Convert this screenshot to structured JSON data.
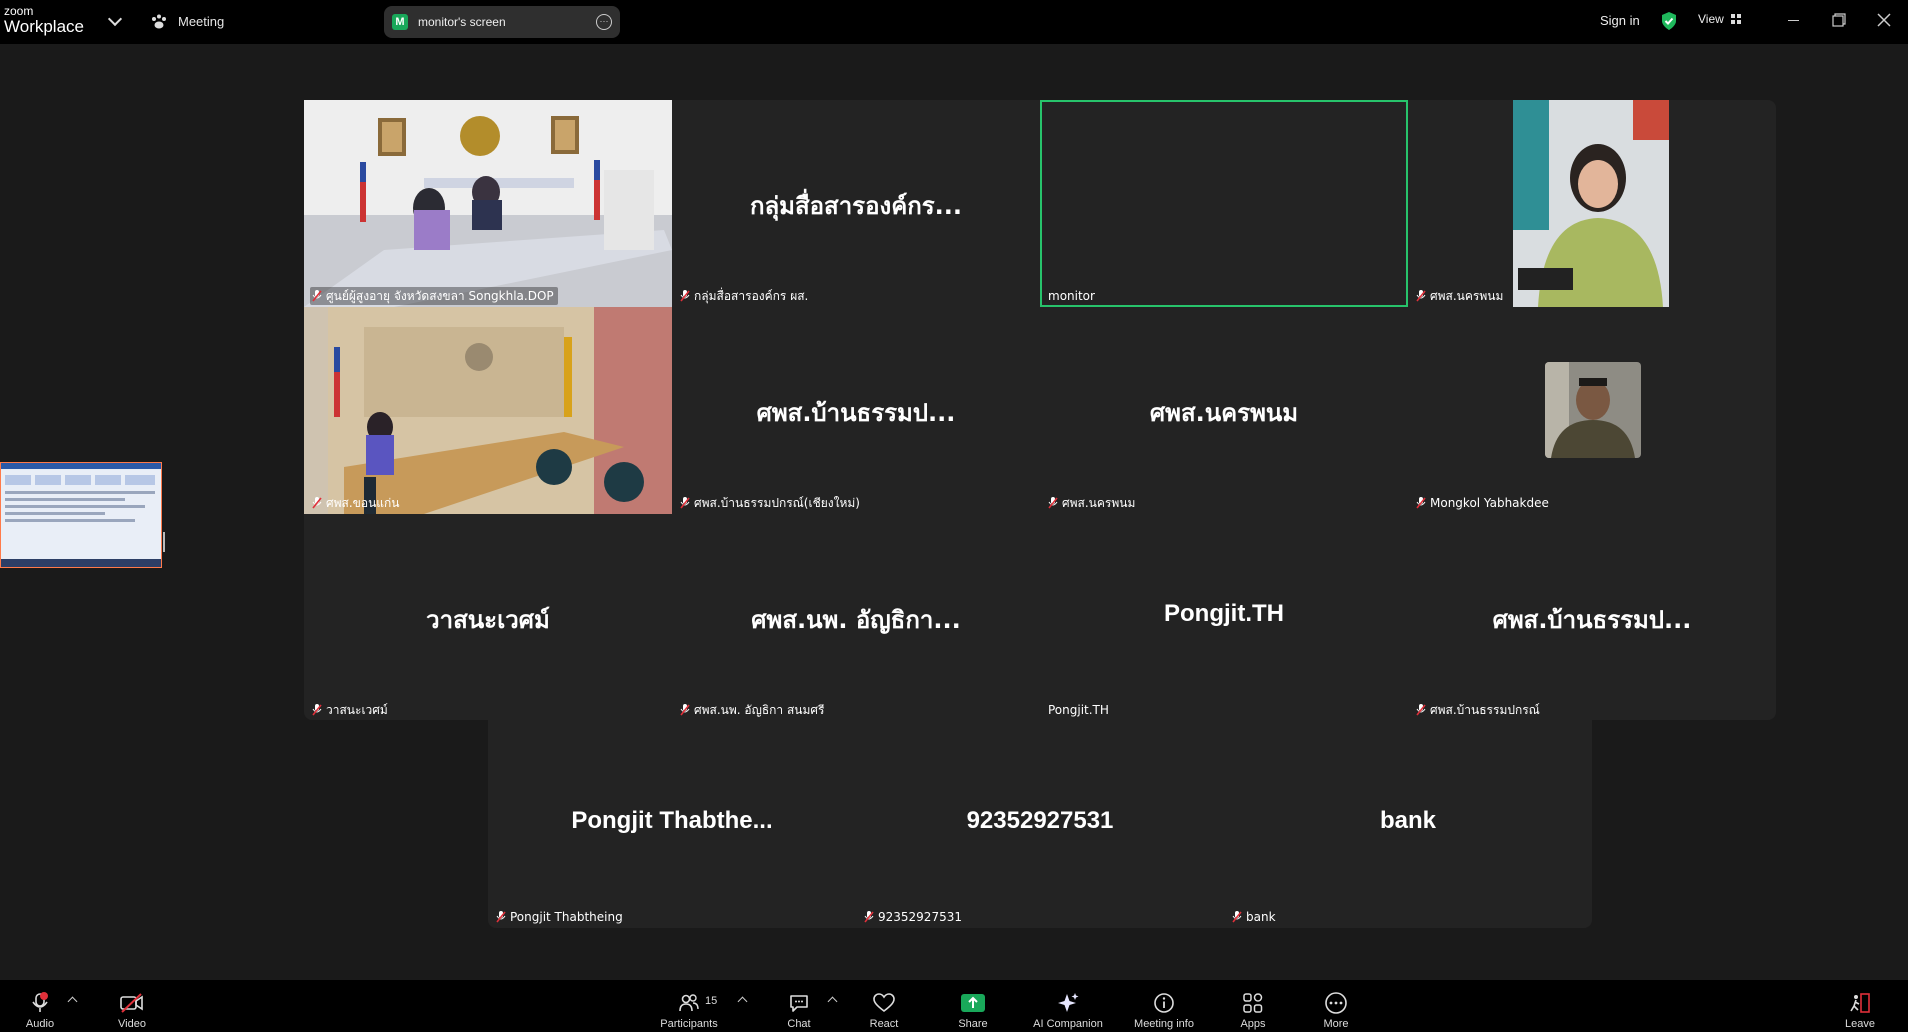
{
  "app": {
    "logo_line1": "zoom",
    "logo_line2": "Workplace",
    "meeting_label": "Meeting",
    "share_pill": {
      "initial": "M",
      "label": "monitor's screen"
    },
    "sign_in": "Sign in",
    "view_label": "View"
  },
  "tiles": [
    {
      "name": "ศูนย์ผู้สูงอายุ จังหวัดสงขลา Songkhla.DOP",
      "display": "",
      "kind": "video",
      "muted": true
    },
    {
      "name": "กลุ่มสื่อสารองค์กร ผส.",
      "display": "กลุ่มสื่อสารองค์กร...",
      "kind": "name",
      "muted": true
    },
    {
      "name": "monitor",
      "display": "",
      "kind": "blank",
      "muted": false,
      "active": true
    },
    {
      "name": "ศพส.นครพนม",
      "display": "",
      "kind": "photo",
      "muted": true
    },
    {
      "name": "ศพส.ขอนแก่น",
      "display": "",
      "kind": "video",
      "muted": true
    },
    {
      "name": "ศพส.บ้านธรรมปกรณ์(เชียงใหม่)",
      "display": "ศพส.บ้านธรรมป...",
      "kind": "name",
      "muted": true
    },
    {
      "name": "ศพส.นครพนม",
      "display": "ศพส.นครพนม",
      "kind": "name",
      "muted": true
    },
    {
      "name": "Mongkol Yabhakdee",
      "display": "",
      "kind": "photo",
      "muted": true
    },
    {
      "name": "วาสนะเวศม์",
      "display": "วาสนะเวศม์",
      "kind": "name",
      "muted": true
    },
    {
      "name": "ศพส.นพ. อัญธิกา สนมศรี",
      "display": "ศพส.นพ. อัญธิกา...",
      "kind": "name",
      "muted": true
    },
    {
      "name": "Pongjit.TH",
      "display": "Pongjit.TH",
      "kind": "name",
      "muted": false
    },
    {
      "name": "ศพส.บ้านธรรมปกรณ์",
      "display": "ศพส.บ้านธรรมป...",
      "kind": "name",
      "muted": true
    },
    {
      "name": "Pongjit Thabtheing",
      "display": "Pongjit Thabthe...",
      "kind": "name",
      "muted": true
    },
    {
      "name": "92352927531",
      "display": "92352927531",
      "kind": "name",
      "muted": true
    },
    {
      "name": "bank",
      "display": "bank",
      "kind": "name",
      "muted": true
    }
  ],
  "toolbar": {
    "audio": "Audio",
    "video": "Video",
    "participants": "Participants",
    "participants_count": "15",
    "chat": "Chat",
    "react": "React",
    "share": "Share",
    "ai_companion": "AI Companion",
    "meeting_info": "Meeting info",
    "apps": "Apps",
    "more": "More",
    "leave": "Leave"
  },
  "colors": {
    "background": "#1a1a1a",
    "tile": "#232323",
    "active_speaker": "#27c36b",
    "share_green": "#19a85a",
    "muted_red": "#e0303a"
  }
}
